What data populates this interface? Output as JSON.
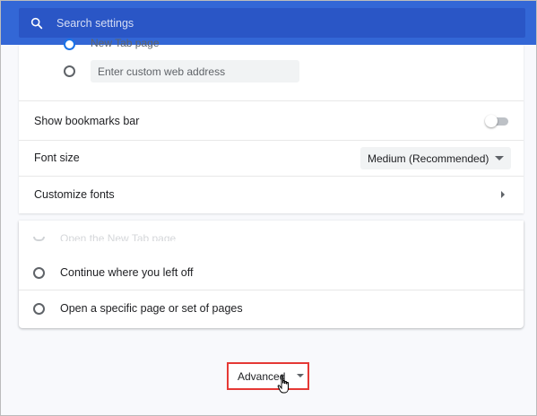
{
  "search": {
    "placeholder": "Search settings",
    "icon": "search-icon"
  },
  "startup_partial": {
    "new_tab_label": "New Tab page",
    "custom_address_placeholder": "Enter custom web address"
  },
  "appearance": {
    "show_bookmarks_bar_label": "Show bookmarks bar",
    "show_bookmarks_bar_on": false,
    "font_size_label": "Font size",
    "font_size_value": "Medium (Recommended)",
    "customize_fonts_label": "Customize fonts"
  },
  "on_startup": {
    "partial_option_label": "Open the New Tab page",
    "continue_label": "Continue where you left off",
    "specific_pages_label": "Open a specific page or set of pages"
  },
  "advanced": {
    "label": "Advanced"
  },
  "colors": {
    "header": "#3367d6",
    "search_box": "#2a56c6",
    "highlight_border": "#e53935"
  }
}
